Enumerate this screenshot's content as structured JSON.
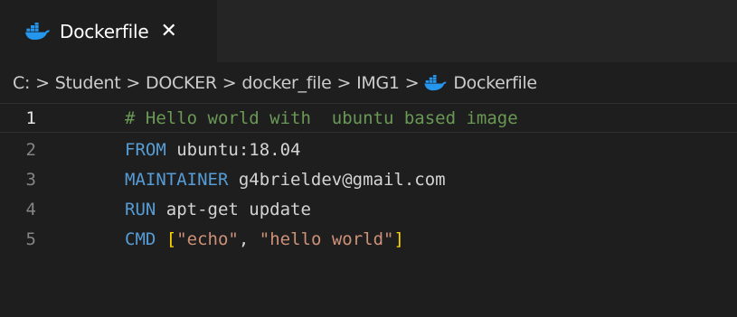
{
  "tab": {
    "label": "Dockerfile",
    "close_glyph": "✕",
    "icon": "docker-whale-icon"
  },
  "breadcrumb": {
    "items": [
      "C:",
      "Student",
      "DOCKER",
      "docker_file",
      "IMG1"
    ],
    "file": "Dockerfile",
    "separator": ">"
  },
  "code": {
    "lines": [
      {
        "number": "1",
        "comment": "# Hello world with  ubuntu based image"
      },
      {
        "number": "2",
        "keyword": "FROM",
        "text": " ubuntu:18.04"
      },
      {
        "number": "3",
        "keyword": "MAINTAINER",
        "text": " g4brieldev@gmail.com"
      },
      {
        "number": "4",
        "keyword": "RUN",
        "text": " apt-get update"
      },
      {
        "number": "5",
        "keyword": "CMD",
        "open": "[",
        "str1": "\"echo\"",
        "comma": ", ",
        "str2": "\"hello world\"",
        "close": "]"
      }
    ]
  },
  "colors": {
    "background": "#1e1e1e",
    "keyword": "#569cd6",
    "comment": "#6a9955",
    "string": "#ce9178",
    "bracket": "#ffd700",
    "docker_icon": "#2496ed"
  }
}
